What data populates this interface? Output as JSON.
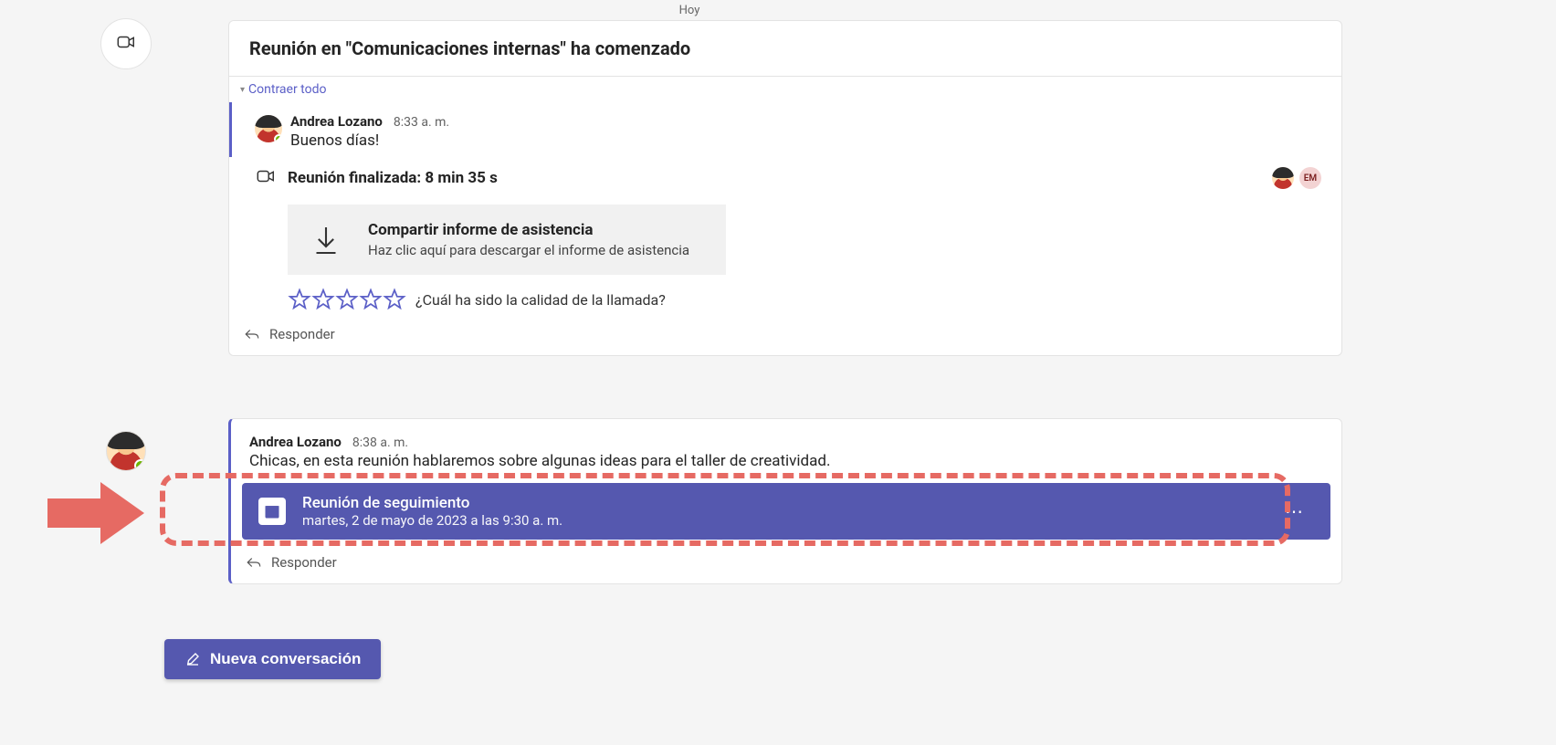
{
  "date_label": "Hoy",
  "meeting_banner": {
    "title": "Reunión en \"Comunicaciones internas\" ha comenzado",
    "collapse_label": "Contraer todo"
  },
  "thread1": {
    "author": "Andrea Lozano",
    "time": "8:33 a. m.",
    "text": "Buenos días!"
  },
  "meeting_ended": {
    "title": "Reunión finalizada: 8 min 35 s",
    "participant_initials": "EM"
  },
  "attendance": {
    "title": "Compartir informe de asistencia",
    "subtitle": "Haz clic aquí para descargar el informe de asistencia"
  },
  "rating": {
    "label": "¿Cuál ha sido la calidad de la llamada?"
  },
  "reply_label": "Responder",
  "thread2": {
    "author": "Andrea Lozano",
    "time": "8:38 a. m.",
    "text": "Chicas, en esta reunión hablaremos sobre algunas ideas para el taller de creatividad."
  },
  "meeting_card": {
    "title": "Reunión de seguimiento",
    "subtitle": "martes, 2 de mayo de 2023 a las 9:30 a. m."
  },
  "new_conversation_label": "Nueva conversación"
}
